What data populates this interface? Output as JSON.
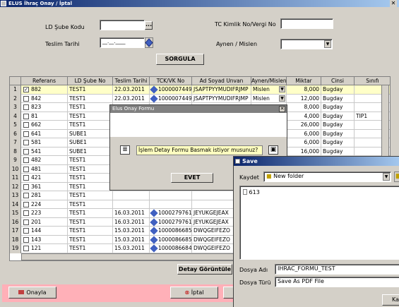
{
  "window": {
    "title": "ELUS İhraç Onay / İptal"
  },
  "form": {
    "ld_sube_kodu_label": "LD Şube Kodu",
    "ld_sube_kodu_value": "",
    "teslim_tarihi_label": "Teslim Tarihi",
    "teslim_tarihi_value": "__.__.____",
    "tc_kimlik_label": "TC Kimlik No/Vergi No",
    "tc_kimlik_value": "",
    "aynen_label": "Aynen / Mislen",
    "aynen_value": "",
    "sorgula": "SORGULA",
    "ellipsis": "..."
  },
  "grid": {
    "headers": [
      "",
      "Referans",
      "LD Şube No",
      "Teslim Tarihi",
      "TCK/VK No",
      "Ad Soyad Unvan",
      "Aynen/Mislen",
      "Miktar",
      "Cinsi",
      "Sınıfı"
    ],
    "rows": [
      {
        "n": "1",
        "checked": "✓",
        "ref": "882",
        "sube": "TEST1",
        "tarih": "22.03.2011",
        "tck": "10000074494",
        "ad": "JSAPTPYYMUDIFRJMP",
        "aynen": "Mislen",
        "miktar": "8,000",
        "cinsi": "Bugday",
        "sinif": ""
      },
      {
        "n": "2",
        "checked": "",
        "ref": "842",
        "sube": "TEST1",
        "tarih": "22.03.2011",
        "tck": "10000074494",
        "ad": "JSAPTPYYMUDIFRJMP",
        "aynen": "Mislen",
        "miktar": "12,000",
        "cinsi": "Bugday",
        "sinif": ""
      },
      {
        "n": "3",
        "checked": "",
        "ref": "823",
        "sube": "TEST1",
        "tarih": "",
        "tck": "",
        "ad": "",
        "aynen": "",
        "miktar": "8,000",
        "cinsi": "Bugday",
        "sinif": ""
      },
      {
        "n": "4",
        "checked": "",
        "ref": "81",
        "sube": "TEST1",
        "tarih": "",
        "tck": "",
        "ad": "",
        "aynen": "",
        "miktar": "4,000",
        "cinsi": "Bugday",
        "sinif": "TIP1"
      },
      {
        "n": "5",
        "checked": "",
        "ref": "662",
        "sube": "TEST1",
        "tarih": "",
        "tck": "",
        "ad": "",
        "aynen": "",
        "miktar": "26,000",
        "cinsi": "Bugday",
        "sinif": ""
      },
      {
        "n": "6",
        "checked": "",
        "ref": "641",
        "sube": "SUBE1",
        "tarih": "",
        "tck": "",
        "ad": "",
        "aynen": "",
        "miktar": "6,000",
        "cinsi": "Bugday",
        "sinif": ""
      },
      {
        "n": "7",
        "checked": "",
        "ref": "581",
        "sube": "SUBE1",
        "tarih": "",
        "tck": "",
        "ad": "",
        "aynen": "",
        "miktar": "6,000",
        "cinsi": "Bugday",
        "sinif": ""
      },
      {
        "n": "8",
        "checked": "",
        "ref": "541",
        "sube": "SUBE1",
        "tarih": "",
        "tck": "",
        "ad": "",
        "aynen": "",
        "miktar": "16,000",
        "cinsi": "Bugday",
        "sinif": ""
      },
      {
        "n": "9",
        "checked": "",
        "ref": "482",
        "sube": "TEST1",
        "tarih": "",
        "tck": "",
        "ad": "",
        "aynen": "",
        "miktar": "",
        "cinsi": "",
        "sinif": ""
      },
      {
        "n": "10",
        "checked": "",
        "ref": "481",
        "sube": "TEST1",
        "tarih": "",
        "tck": "",
        "ad": "",
        "aynen": "",
        "miktar": "",
        "cinsi": "",
        "sinif": ""
      },
      {
        "n": "11",
        "checked": "",
        "ref": "421",
        "sube": "TEST1",
        "tarih": "",
        "tck": "",
        "ad": "",
        "aynen": "",
        "miktar": "",
        "cinsi": "",
        "sinif": ""
      },
      {
        "n": "12",
        "checked": "",
        "ref": "361",
        "sube": "TEST1",
        "tarih": "",
        "tck": "",
        "ad": "",
        "aynen": "",
        "miktar": "",
        "cinsi": "",
        "sinif": ""
      },
      {
        "n": "13",
        "checked": "",
        "ref": "281",
        "sube": "TEST1",
        "tarih": "",
        "tck": "",
        "ad": "",
        "aynen": "",
        "miktar": "",
        "cinsi": "",
        "sinif": ""
      },
      {
        "n": "14",
        "checked": "",
        "ref": "224",
        "sube": "TEST1",
        "tarih": "",
        "tck": "",
        "ad": "",
        "aynen": "",
        "miktar": "",
        "cinsi": "",
        "sinif": ""
      },
      {
        "n": "15",
        "checked": "",
        "ref": "223",
        "sube": "TEST1",
        "tarih": "16.03.2011",
        "tck": "10002797618",
        "ad": "JEYUKGEJEAX",
        "aynen": "",
        "miktar": "",
        "cinsi": "",
        "sinif": ""
      },
      {
        "n": "16",
        "checked": "",
        "ref": "201",
        "sube": "TEST1",
        "tarih": "16.03.2011",
        "tck": "10002797618",
        "ad": "JEYUKGEJEAX",
        "aynen": "",
        "miktar": "",
        "cinsi": "",
        "sinif": ""
      },
      {
        "n": "17",
        "checked": "",
        "ref": "144",
        "sube": "TEST1",
        "tarih": "15.03.2011",
        "tck": "10000866850",
        "ad": "DWQGEIFEZO",
        "aynen": "",
        "miktar": "",
        "cinsi": "",
        "sinif": ""
      },
      {
        "n": "18",
        "checked": "",
        "ref": "143",
        "sube": "TEST1",
        "tarih": "15.03.2011",
        "tck": "10000866850",
        "ad": "DWQGEIFEZO",
        "aynen": "",
        "miktar": "",
        "cinsi": "",
        "sinif": ""
      },
      {
        "n": "19",
        "checked": "",
        "ref": "121",
        "sube": "TEST1",
        "tarih": "15.03.2011",
        "tck": "10000866847",
        "ad": "DWQGEIFEZO",
        "aynen": "",
        "miktar": "",
        "cinsi": "",
        "sinif": ""
      }
    ]
  },
  "detay_button": "Detay Görüntüle",
  "footer": {
    "onayla": "Onayla",
    "iptal": "İptal"
  },
  "dialog": {
    "title": "Elus Onay Formu",
    "message": "İşlem Detay Formu Basmak istiyor musunuz?",
    "evet": "EVET"
  },
  "save_dialog": {
    "title": "Save",
    "kaydet_label": "Kaydet",
    "folder": "New folder",
    "file_item": "613",
    "dosya_adi_label": "Dosya Adı",
    "dosya_adi_value": "IHRAC_FORMU_TEST",
    "dosya_turu_label": "Dosya Türü",
    "dosya_turu_value": "Save As PDF File",
    "kaydet_button": "Kay"
  },
  "colors": {
    "title": "#0a246a",
    "selected_row": "#ffffc8",
    "footer_band": "#ffb0b8",
    "dialog_msg": "#ffffc0"
  }
}
